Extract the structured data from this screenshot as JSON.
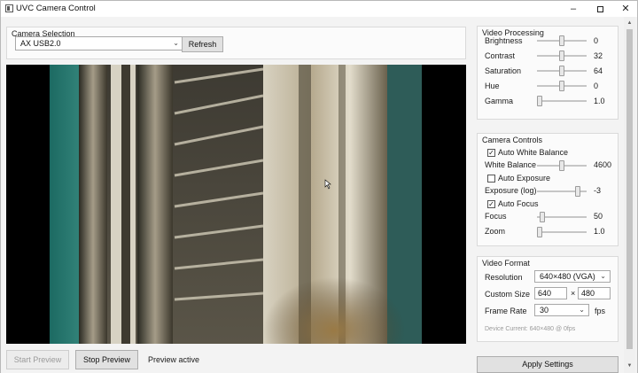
{
  "window": {
    "title": "UVC Camera Control"
  },
  "camera_selection": {
    "title": "Camera Selection",
    "selected_camera": "AX USB2.0",
    "refresh_label": "Refresh"
  },
  "preview_controls": {
    "start_label": "Start Preview",
    "stop_label": "Stop Preview",
    "status": "Preview active"
  },
  "video_processing": {
    "title": "Video Processing",
    "rows": [
      {
        "label": "Brightness",
        "value": "0",
        "level": 0.5
      },
      {
        "label": "Contrast",
        "value": "32",
        "level": 0.5
      },
      {
        "label": "Saturation",
        "value": "64",
        "level": 0.5
      },
      {
        "label": "Hue",
        "value": "0",
        "level": 0.5
      },
      {
        "label": "Gamma",
        "value": "1.0",
        "level": 0.0
      }
    ]
  },
  "camera_controls": {
    "title": "Camera Controls",
    "auto_white_balance": {
      "label": "Auto White Balance",
      "checked": true
    },
    "white_balance": {
      "label": "White Balance",
      "value": "4600",
      "level": 0.5
    },
    "auto_exposure": {
      "label": "Auto Exposure",
      "checked": false
    },
    "exposure": {
      "label": "Exposure (log)",
      "value": "-3",
      "level": 0.85
    },
    "auto_focus": {
      "label": "Auto Focus",
      "checked": true
    },
    "focus": {
      "label": "Focus",
      "value": "50",
      "level": 0.05
    },
    "zoom": {
      "label": "Zoom",
      "value": "1.0",
      "level": 0.0
    }
  },
  "video_format": {
    "title": "Video Format",
    "resolution_label": "Resolution",
    "resolution_value": "640×480 (VGA)",
    "custom_size_label": "Custom Size",
    "custom_width": "640",
    "size_separator": "×",
    "custom_height": "480",
    "frame_rate_label": "Frame Rate",
    "frame_rate_value": "30",
    "fps_unit": "fps",
    "device_current": "Device Current: 640×480 @ 0fps"
  },
  "apply_label": "Apply Settings",
  "icons": {
    "minimize": "minimize-icon",
    "maximize": "maximize-icon",
    "close": "close-icon",
    "dropdown": "chevron-down-icon",
    "check": "checkmark-icon"
  }
}
